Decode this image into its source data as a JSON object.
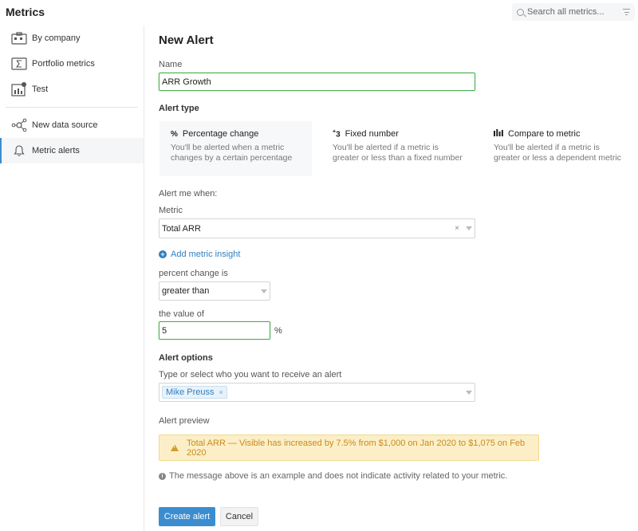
{
  "app": {
    "title": "Metrics"
  },
  "search": {
    "placeholder": "Search all metrics..."
  },
  "sidebar": {
    "items": [
      {
        "label": "By company"
      },
      {
        "label": "Portfolio metrics"
      },
      {
        "label": "Test"
      },
      {
        "label": "New data source"
      },
      {
        "label": "Metric alerts"
      }
    ]
  },
  "form": {
    "title": "New Alert",
    "name_label": "Name",
    "name_value": "ARR Growth",
    "alert_type_label": "Alert type",
    "types": [
      {
        "icon": "%",
        "title": "Percentage change",
        "desc": "You'll be alerted when a metric changes by a certain percentage"
      },
      {
        "icon": "+3",
        "title": "Fixed number",
        "desc": "You'll be alerted if a metric is greater or less than a fixed number"
      },
      {
        "icon": "bars",
        "title": "Compare to metric",
        "desc": "You'll be alerted if a metric is greater or less a dependent metric"
      }
    ],
    "alert_when_label": "Alert me when:",
    "metric_label": "Metric",
    "metric_value": "Total ARR",
    "metric_clear": "×",
    "add_insight": "Add metric insight",
    "percent_change_label": "percent change is",
    "comparison_value": "greater than",
    "value_of_label": "the value of",
    "value": "5",
    "unit": "%",
    "options_label": "Alert options",
    "recipients_label": "Type or select who you want to receive an alert",
    "recipient": "Mike Preuss",
    "recipient_remove": "×",
    "preview_label": "Alert preview",
    "preview_text": "Total ARR — Visible has increased by 7.5% from $1,000 on Jan 2020 to $1,075 on Feb 2020",
    "note": "The message above is an example and does not indicate activity related to your metric.",
    "create_button": "Create alert",
    "cancel_button": "Cancel"
  },
  "colors": {
    "accent": "#3b8dd0",
    "focus_border": "#4caf50",
    "warning_bg": "#fcefc7",
    "warning_text": "#c88a1d"
  }
}
